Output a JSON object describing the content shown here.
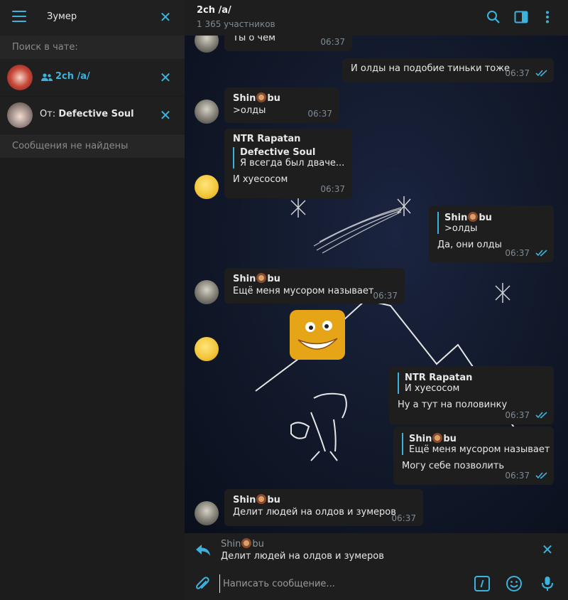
{
  "left": {
    "search_query": "Зумер",
    "scope_label": "Поиск в чате:",
    "chat_filter": "2ch /a/",
    "from_prefix": "От:",
    "from_name": "Defective Soul",
    "not_found": "Сообщения не найдены"
  },
  "header": {
    "title": "2ch /a/",
    "subtitle": "1 365 участников"
  },
  "messages": {
    "m1": {
      "text": "Ты о чем",
      "time": "06:37"
    },
    "m2": {
      "text": "И олды на подобие тиньки тоже",
      "time": "06:37"
    },
    "m3": {
      "author_a": "Shin",
      "author_b": "bu",
      "text": ">олды",
      "time": "06:37"
    },
    "m4": {
      "author": "NTR Rapatan",
      "reply_name": "Defective Soul",
      "reply_text": "Я всегда был дваче...",
      "text": "И хуесосом",
      "time": "06:37"
    },
    "m5": {
      "reply_name_a": "Shin",
      "reply_name_b": "bu",
      "reply_text": ">олды",
      "text": "Да, они олды",
      "time": "06:37"
    },
    "m6": {
      "author_a": "Shin",
      "author_b": "bu",
      "text": "Ещё меня мусором называет",
      "time": "06:37"
    },
    "m7": {
      "reply_name": "NTR Rapatan",
      "reply_text": "И хуесосом",
      "text": "Ну а тут на половинку",
      "time": "06:37"
    },
    "m8": {
      "reply_name_a": "Shin",
      "reply_name_b": "bu",
      "reply_text": "Ещё меня мусором называет",
      "text": "Могу себе позволить",
      "time": "06:37"
    },
    "m9": {
      "author_a": "Shin",
      "author_b": "bu",
      "text": "Делит людей на олдов и зумеров",
      "time": "06:37"
    }
  },
  "reply_bar": {
    "name_a": "Shin",
    "name_b": "bu",
    "text": "Делит людей на олдов и зумеров"
  },
  "composer": {
    "placeholder": "Написать сообщение..."
  },
  "colors": {
    "accent": "#3cb3dd",
    "panel": "#1c1c1c",
    "bubble": "#1e1e1e"
  },
  "icons": [
    "menu-icon",
    "close-icon",
    "group-icon",
    "search-icon",
    "sidebar-toggle-icon",
    "more-icon",
    "double-check-icon",
    "reply-arrow-icon",
    "attach-icon",
    "commands-icon",
    "emoji-icon",
    "microphone-icon"
  ]
}
